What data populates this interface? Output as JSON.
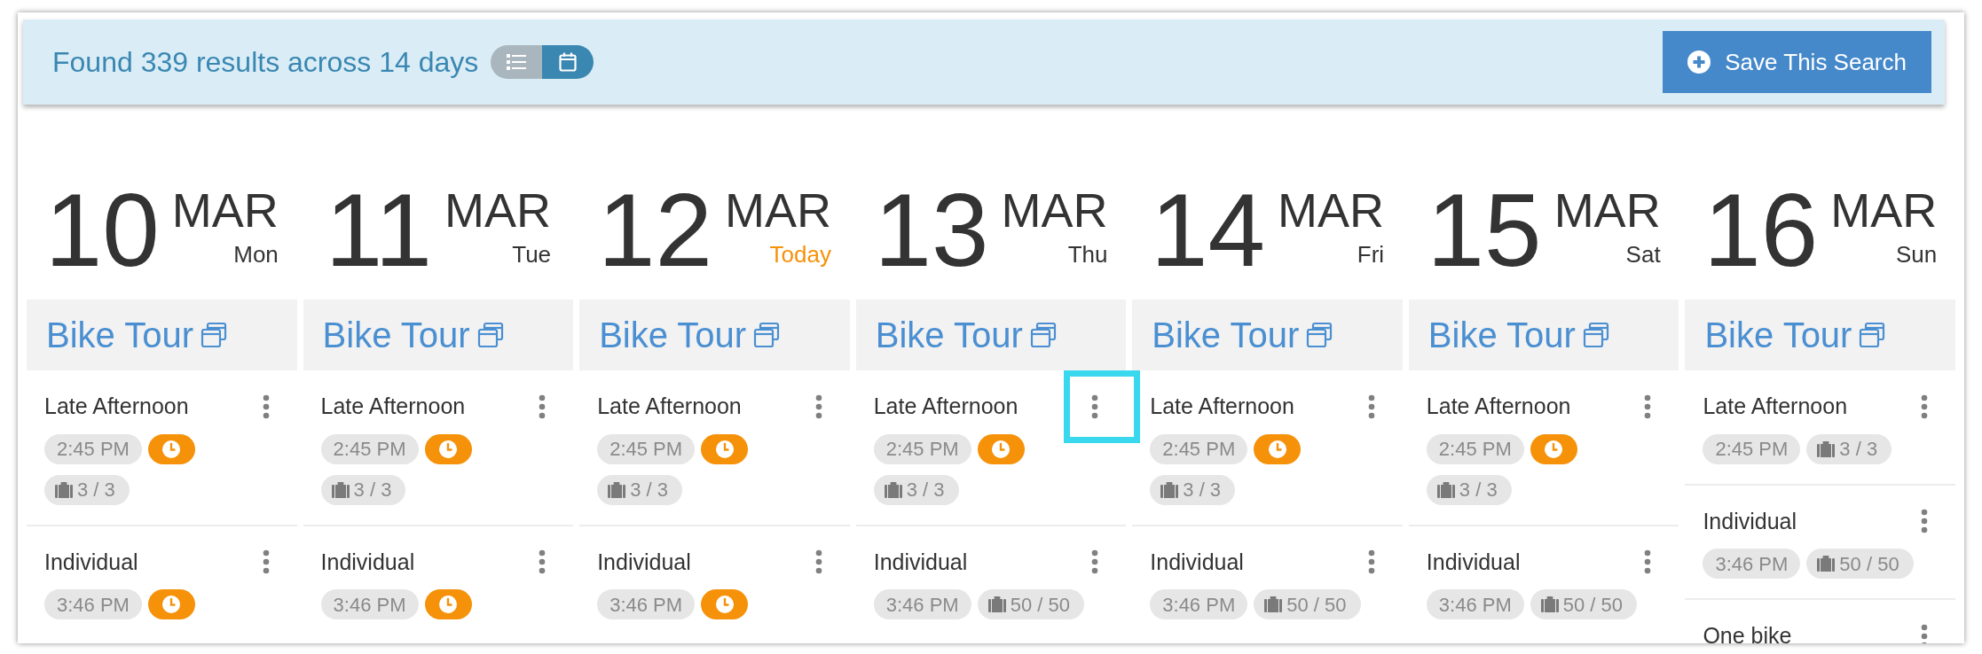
{
  "header": {
    "summary": "Found 339 results across 14 days",
    "view_toggle": [
      {
        "kind": "list",
        "selected": false
      },
      {
        "kind": "calendar",
        "selected": true
      }
    ],
    "save_button": "Save This Search"
  },
  "days": [
    {
      "day": "10",
      "month": "MAR",
      "weekday": "Mon",
      "today": false,
      "tour": "Bike Tour",
      "slots": [
        {
          "name": "Late Afternoon",
          "time": "2:45 PM",
          "timer": true,
          "capacity": "3 / 3",
          "highlighted": false
        },
        {
          "name": "Individual",
          "time": "3:46 PM",
          "timer": true,
          "highlighted": false
        }
      ]
    },
    {
      "day": "11",
      "month": "MAR",
      "weekday": "Tue",
      "today": false,
      "tour": "Bike Tour",
      "slots": [
        {
          "name": "Late Afternoon",
          "time": "2:45 PM",
          "timer": true,
          "capacity": "3 / 3",
          "highlighted": false
        },
        {
          "name": "Individual",
          "time": "3:46 PM",
          "timer": true,
          "highlighted": false
        }
      ]
    },
    {
      "day": "12",
      "month": "MAR",
      "weekday": "Today",
      "today": true,
      "tour": "Bike Tour",
      "slots": [
        {
          "name": "Late Afternoon",
          "time": "2:45 PM",
          "timer": true,
          "capacity": "3 / 3",
          "highlighted": false
        },
        {
          "name": "Individual",
          "time": "3:46 PM",
          "timer": true,
          "highlighted": false
        }
      ]
    },
    {
      "day": "13",
      "month": "MAR",
      "weekday": "Thu",
      "today": false,
      "tour": "Bike Tour",
      "slots": [
        {
          "name": "Late Afternoon",
          "time": "2:45 PM",
          "timer": true,
          "capacity": "3 / 3",
          "highlighted": true
        },
        {
          "name": "Individual",
          "time": "3:46 PM",
          "timer": false,
          "capacity": "50 / 50",
          "highlighted": false
        }
      ]
    },
    {
      "day": "14",
      "month": "MAR",
      "weekday": "Fri",
      "today": false,
      "tour": "Bike Tour",
      "slots": [
        {
          "name": "Late Afternoon",
          "time": "2:45 PM",
          "timer": true,
          "capacity": "3 / 3",
          "highlighted": false
        },
        {
          "name": "Individual",
          "time": "3:46 PM",
          "timer": false,
          "capacity": "50 / 50",
          "highlighted": false
        }
      ]
    },
    {
      "day": "15",
      "month": "MAR",
      "weekday": "Sat",
      "today": false,
      "tour": "Bike Tour",
      "slots": [
        {
          "name": "Late Afternoon",
          "time": "2:45 PM",
          "timer": true,
          "capacity": "3 / 3",
          "highlighted": false
        },
        {
          "name": "Individual",
          "time": "3:46 PM",
          "timer": false,
          "capacity": "50 / 50",
          "highlighted": false
        }
      ]
    },
    {
      "day": "16",
      "month": "MAR",
      "weekday": "Sun",
      "today": false,
      "tour": "Bike Tour",
      "slots": [
        {
          "name": "Late Afternoon",
          "time": "2:45 PM",
          "timer": false,
          "capacity": "3 / 3",
          "highlighted": false
        },
        {
          "name": "Individual",
          "time": "3:46 PM",
          "timer": false,
          "capacity": "50 / 50",
          "highlighted": false
        },
        {
          "name": "One bike",
          "highlighted": false
        }
      ]
    }
  ]
}
